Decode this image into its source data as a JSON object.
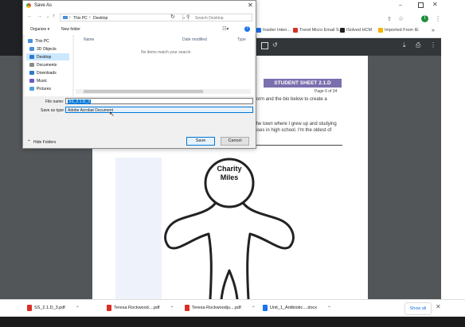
{
  "browser": {
    "bookmarks": [
      {
        "label": "Insider Inten...",
        "color": "#1a73e8"
      },
      {
        "label": "Trend Micro Email S...",
        "color": "#d93025"
      },
      {
        "label": "iSolved HCM",
        "color": "#202124"
      },
      {
        "label": "Imported From IE",
        "color": "#f4b400"
      }
    ],
    "more_bookmarks": "»",
    "avatar_letter": "T"
  },
  "pdf": {
    "sheet_title": "STUDENT SHEET 2.1.D",
    "page_label": "Page 6 of 34",
    "line1": "form and the bio below to create a",
    "line2": "the town where I grew up and studying",
    "line3": "sses in high school. I'm the oldest of",
    "character_first": "Charity",
    "character_last": "Miles"
  },
  "downloads": [
    {
      "name": "SS_2.1.D_3.pdf",
      "color": "#d93025"
    },
    {
      "name": "Teresa Rockwood....pdf",
      "color": "#d93025"
    },
    {
      "name": "Teresa Rockwoodju....pdf",
      "color": "#d93025"
    },
    {
      "name": "Unit_1_Antibiotic....docx",
      "color": "#1a73e8"
    }
  ],
  "show_all": "Show all",
  "dialog": {
    "title": "Save As",
    "path_root": "This PC",
    "path_current": "Desktop",
    "search_placeholder": "Search Desktop",
    "organize": "Organize ▾",
    "new_folder": "New folder",
    "col_name": "Name",
    "col_date": "Date modified",
    "col_type": "Type",
    "empty_message": "No items match your search.",
    "nav_items": [
      {
        "label": "This PC",
        "color": "#4a90d9"
      },
      {
        "label": "3D Objects",
        "color": "#4a90d9"
      },
      {
        "label": "Desktop",
        "color": "#2a7bd0"
      },
      {
        "label": "Documents",
        "color": "#8a8a8a"
      },
      {
        "label": "Downloads",
        "color": "#2a7bd0"
      },
      {
        "label": "Music",
        "color": "#6a5acd"
      },
      {
        "label": "Pictures",
        "color": "#4aa3df"
      }
    ],
    "file_name_label": "File name:",
    "file_name_value": "SS_2.1.D_3",
    "save_type_label": "Save as type:",
    "save_type_value": "Adobe Acrobat Document",
    "hide_folders": "Hide Folders",
    "save_button": "Save",
    "cancel_button": "Cancel"
  }
}
